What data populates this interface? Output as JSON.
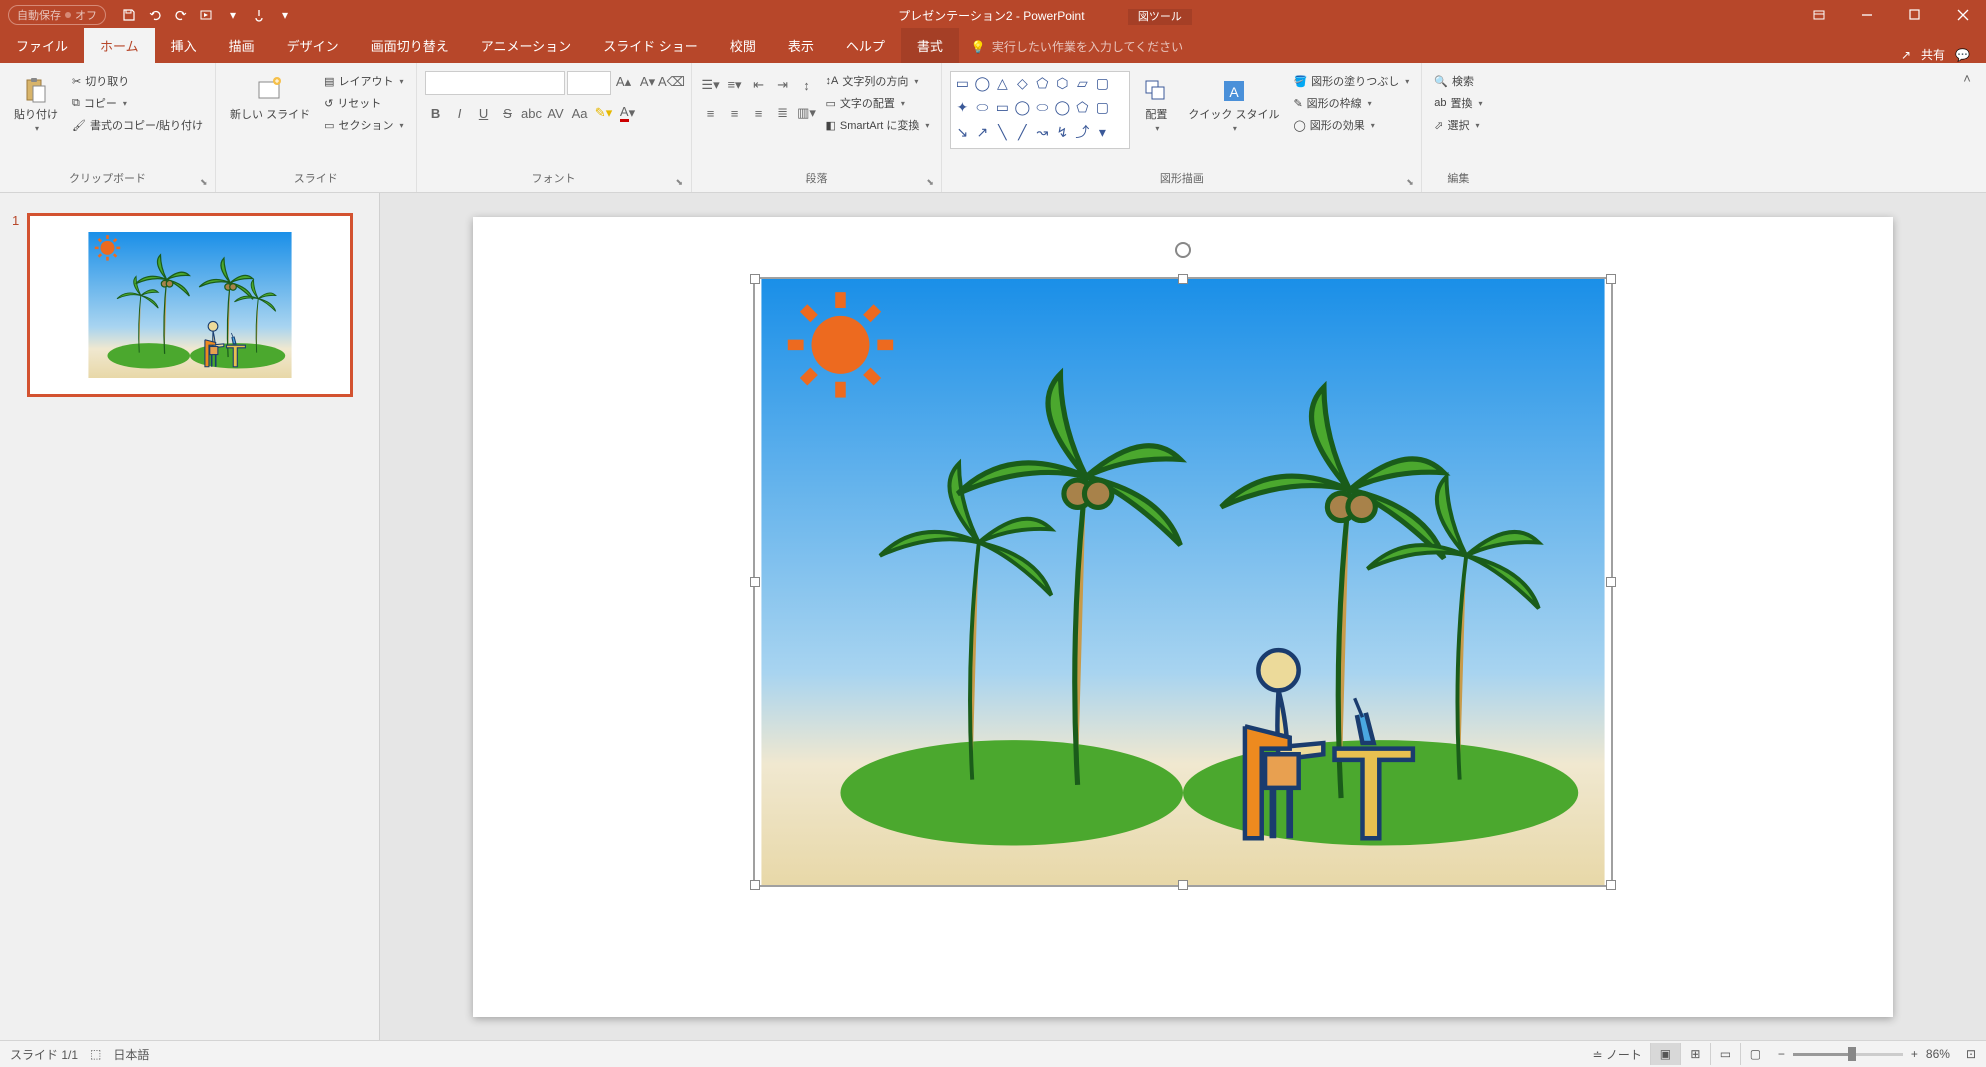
{
  "titlebar": {
    "autosave": "自動保存",
    "autosave_state": "オフ",
    "title": "プレゼンテーション2 - PowerPoint",
    "contextual": "図ツール"
  },
  "tabs": {
    "file": "ファイル",
    "home": "ホーム",
    "insert": "挿入",
    "draw": "描画",
    "design": "デザイン",
    "transitions": "画面切り替え",
    "animations": "アニメーション",
    "slideshow": "スライド ショー",
    "review": "校閲",
    "view": "表示",
    "help": "ヘルプ",
    "format": "書式"
  },
  "tell_me": "実行したい作業を入力してください",
  "share": "共有",
  "clipboard": {
    "group": "クリップボード",
    "paste": "貼り付け",
    "cut": "切り取り",
    "copy": "コピー",
    "format_painter": "書式のコピー/貼り付け"
  },
  "slides": {
    "group": "スライド",
    "new_slide": "新しい\nスライド",
    "layout": "レイアウト",
    "reset": "リセット",
    "section": "セクション"
  },
  "font": {
    "group": "フォント",
    "name": "",
    "size": ""
  },
  "paragraph": {
    "group": "段落",
    "text_direction": "文字列の方向",
    "align_text": "文字の配置",
    "smartart": "SmartArt に変換"
  },
  "drawing": {
    "group": "図形描画",
    "arrange": "配置",
    "quick_styles": "クイック\nスタイル",
    "shape_fill": "図形の塗りつぶし",
    "shape_outline": "図形の枠線",
    "shape_effects": "図形の効果"
  },
  "editing": {
    "group": "編集",
    "find": "検索",
    "replace": "置換",
    "select": "選択"
  },
  "thumb": {
    "number": "1"
  },
  "status": {
    "slide": "スライド 1/1",
    "lang": "日本語",
    "notes": "ノート",
    "zoom": "86%"
  }
}
